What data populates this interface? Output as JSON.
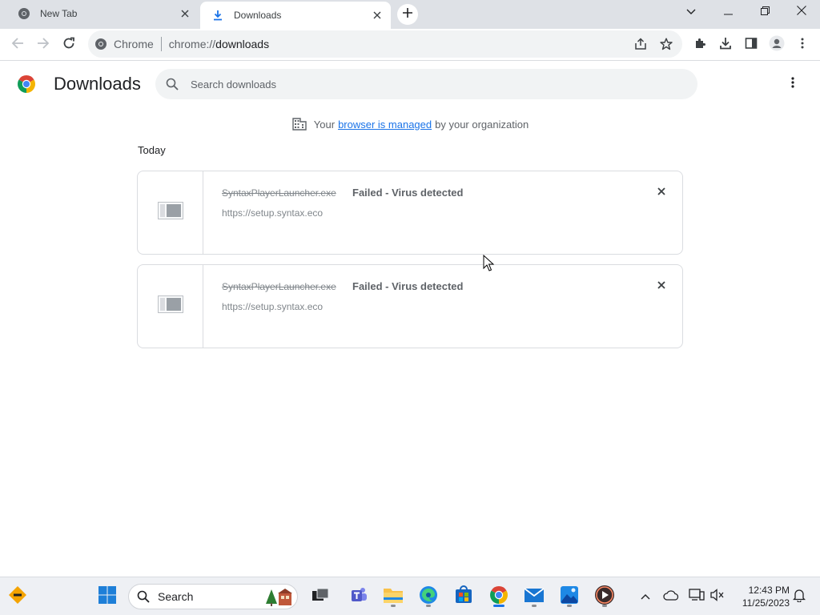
{
  "tabs": [
    {
      "title": "New Tab",
      "icon": "chrome-icon",
      "active": false
    },
    {
      "title": "Downloads",
      "icon": "download-icon",
      "active": true
    }
  ],
  "toolbar": {
    "site_chip": "Chrome",
    "url_scheme": "chrome://",
    "url_host": "downloads"
  },
  "page": {
    "title": "Downloads",
    "search_placeholder": "Search downloads",
    "managed": {
      "prefix": "Your",
      "link": "browser is managed",
      "suffix": "by your organization"
    },
    "section": "Today"
  },
  "downloads": [
    {
      "filename": "SyntaxPlayerLauncher.exe",
      "status": "Failed - Virus detected",
      "source": "https://setup.syntax.eco"
    },
    {
      "filename": "SyntaxPlayerLauncher.exe",
      "status": "Failed - Virus detected",
      "source": "https://setup.syntax.eco"
    }
  ],
  "taskbar": {
    "search_label": "Search",
    "time": "12:43 PM",
    "date": "11/25/2023"
  },
  "colors": {
    "accent": "#1a73e8",
    "tabstrip": "#dee1e6",
    "omnibox": "#f1f3f4"
  }
}
